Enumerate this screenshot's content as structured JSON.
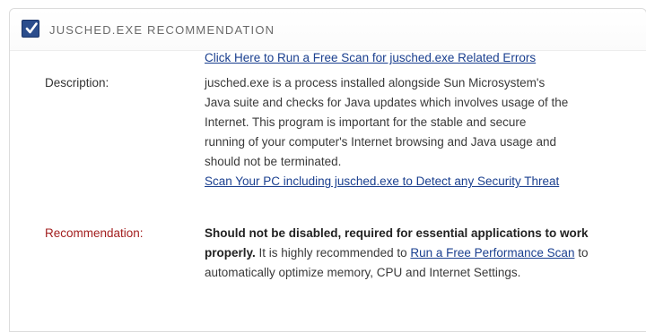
{
  "header": {
    "title": "JUSCHED.EXE RECOMMENDATION",
    "checkbox_icon": "checkmark-icon",
    "accent_color": "#2b4d8c"
  },
  "scan_link": "Click Here to Run a Free Scan for jusched.exe Related Errors",
  "description": {
    "label": "Description:",
    "lines": [
      "jusched.exe is a process installed alongside Sun Microsystem's",
      "Java suite and checks for Java updates which involves usage of the",
      "Internet. This program is important for the stable and secure",
      "running of your computer's Internet browsing and Java usage and",
      "should not be terminated."
    ],
    "detect_link": "Scan Your PC including jusched.exe to Detect any Security Threat"
  },
  "recommendation": {
    "label": "Recommendation:",
    "label_color": "#a32020",
    "bold_text": "Should not be disabled, required for essential applications to work properly.",
    "text_before_link": " It is highly recommended to ",
    "link_text": "Run a Free Performance Scan",
    "text_after_link": " to automatically optimize memory, CPU and Internet Settings."
  }
}
